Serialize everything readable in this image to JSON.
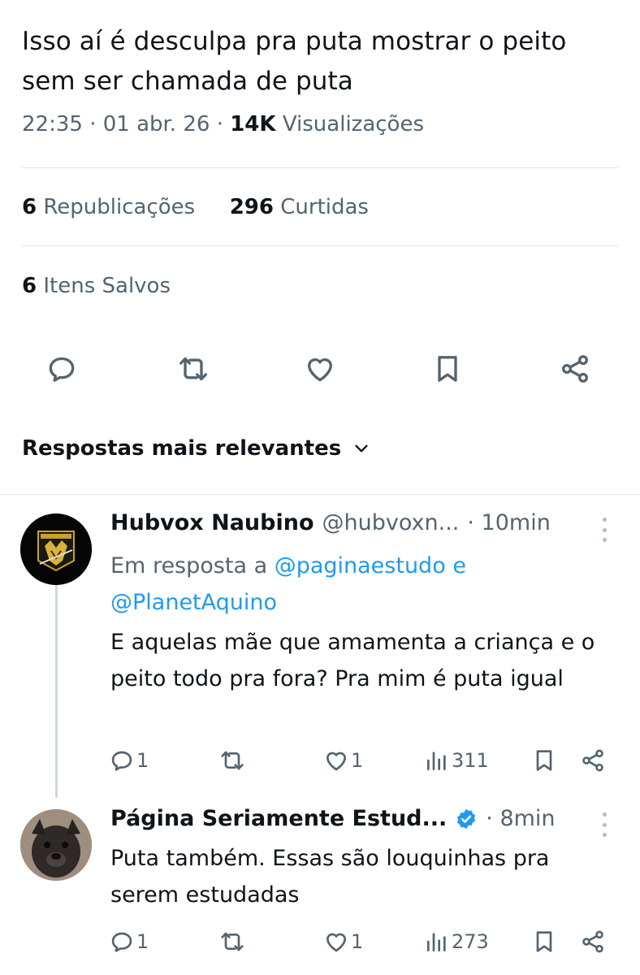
{
  "tweet": {
    "text": "Isso aí é desculpa pra puta mostrar o peito sem ser chamada de puta",
    "time": "22:35 · 01 abr. 26 · ",
    "views_count": "14K",
    "views_label": " Visualizações",
    "reposts_count": "6",
    "reposts_label": " Republicações",
    "likes_count": "296",
    "likes_label": " Curtidas",
    "bookmarks_count": "6",
    "bookmarks_label": " Itens Salvos"
  },
  "actions": {
    "icons": [
      "reply-icon",
      "retweet-icon",
      "like-icon",
      "bookmark-icon",
      "share-icon"
    ]
  },
  "sort": {
    "label": "Respostas mais relevantes"
  },
  "replies": [
    {
      "name": "Hubvox Naubino",
      "handle": "@hubvoxn...",
      "time": "· 10min",
      "in_reply_prefix": "Em resposta a ",
      "mention1": "@paginaestudo",
      "mention_join": " e ",
      "mention2": "@PlanetAquino",
      "text": "E aquelas mãe que amamenta a criança e o peito todo pra fora? Pra mim é puta igual",
      "reply_count": "1",
      "like_count": "1",
      "views": "311"
    },
    {
      "name": "Página Seriamente Estud...",
      "handle": "",
      "verified": true,
      "time": "· 8min",
      "text": "Puta também. Essas são louquinhas pra serem estudadas",
      "reply_count": "1",
      "like_count": "1",
      "views": "273"
    }
  ],
  "colors": {
    "text": "#0f1419",
    "secondary": "#536471",
    "link": "#1d9bf0",
    "divider": "#e1e6ea"
  }
}
